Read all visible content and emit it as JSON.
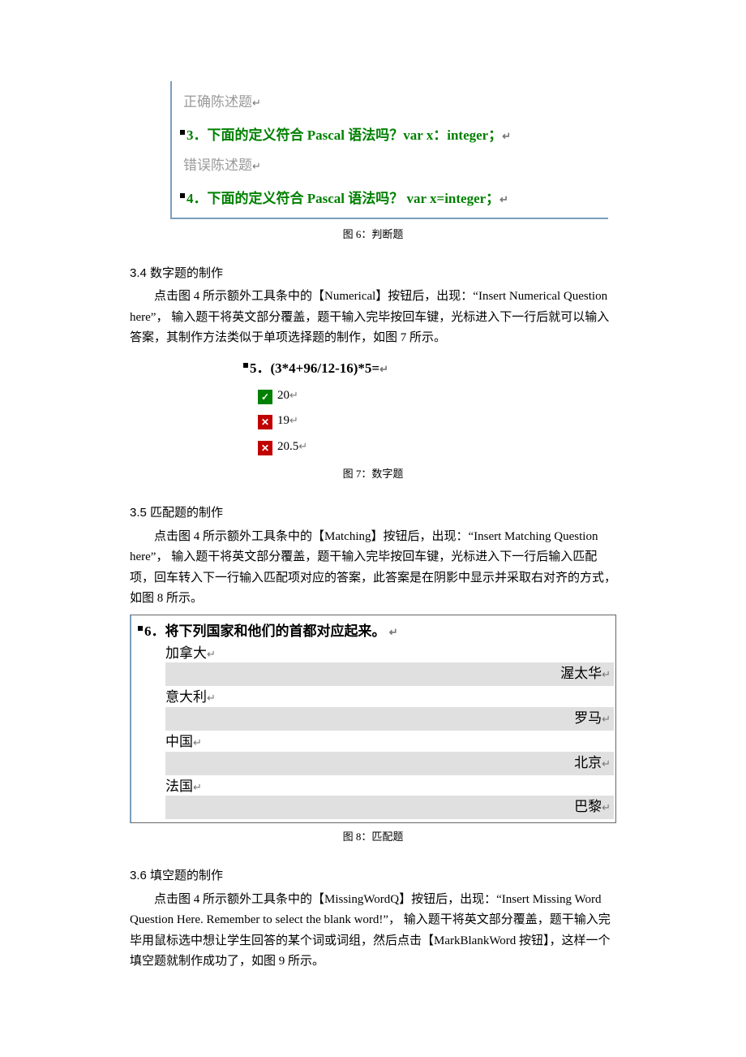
{
  "fig6": {
    "label_correct": "正确陈述题",
    "q3": "3．下面的定义符合 Pascal 语法吗？var x：integer；",
    "label_wrong": "错误陈述题",
    "q4": "4．下面的定义符合 Pascal 语法吗？ var x=integer；",
    "caption": "图 6：判断题"
  },
  "sec34": {
    "heading": "3.4 数字题的制作",
    "para": "点击图 4 所示额外工具条中的【Numerical】按钮后，出现：“Insert Numerical Question here”，  输入题干将英文部分覆盖，题干输入完毕按回车键，光标进入下一行后就可以输入答案，其制作方法类似于单项选择题的制作，如图 7 所示。"
  },
  "fig7": {
    "q": "5．(3*4+96/12-16)*5=",
    "opt1": "20",
    "opt2": "19",
    "opt3": "20.5",
    "caption": "图 7：数字题"
  },
  "sec35": {
    "heading": "3.5 匹配题的制作",
    "para": "点击图 4 所示额外工具条中的【Matching】按钮后，出现：“Insert Matching Question here”，  输入题干将英文部分覆盖，题干输入完毕按回车键，光标进入下一行后输入匹配项，回车转入下一行输入匹配项对应的答案，此答案是在阴影中显示并采取右对齐的方式，如图 8 所示。"
  },
  "fig8": {
    "q": "6．将下列国家和他们的首都对应起来。",
    "pairs": [
      {
        "item": "加拿大",
        "ans": "渥太华"
      },
      {
        "item": "意大利",
        "ans": "罗马"
      },
      {
        "item": "中国",
        "ans": "北京"
      },
      {
        "item": "法国",
        "ans": "巴黎"
      }
    ],
    "caption": "图 8：匹配题"
  },
  "sec36": {
    "heading": "3.6 填空题的制作",
    "para": "点击图 4 所示额外工具条中的【MissingWordQ】按钮后，出现：“Insert Missing Word Question Here. Remember to select the blank word!”，  输入题干将英文部分覆盖，题干输入完毕用鼠标选中想让学生回答的某个词或词组，然后点击【MarkBlankWord 按钮】，这样一个填空题就制作成功了，如图 9 所示。"
  }
}
